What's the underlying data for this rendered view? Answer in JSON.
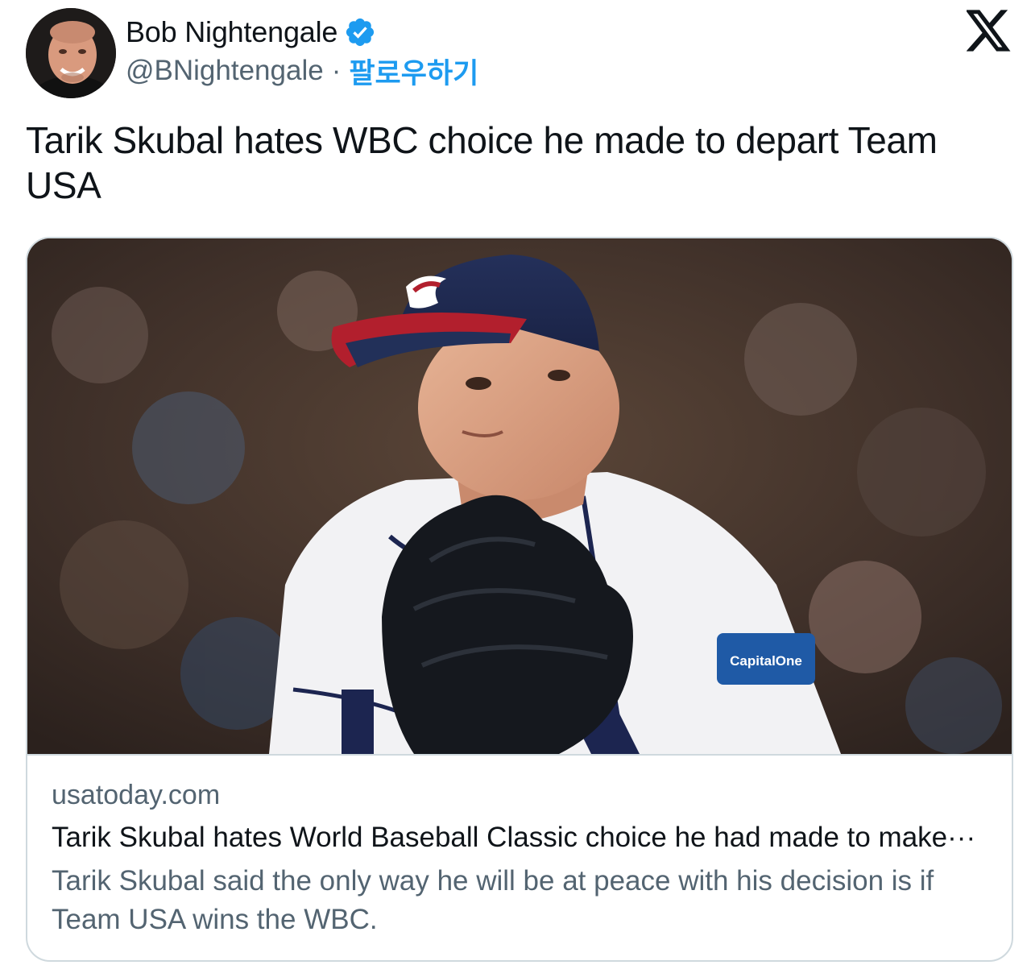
{
  "author": {
    "display_name": "Bob Nightengale",
    "handle": "@BNightengale",
    "separator": "·",
    "follow_label": "팔로우하기",
    "avatar_icon": "avatar-photo",
    "verified_icon": "verified-badge-icon"
  },
  "platform": {
    "logo_icon": "x-logo-icon"
  },
  "tweet": {
    "text": "Tarik Skubal hates WBC choice he made to depart Team USA"
  },
  "card": {
    "image_icon": "article-photo",
    "image_text": {
      "sponsor_patch": "CapitalOne"
    },
    "domain": "usatoday.com",
    "title": "Tarik Skubal hates World Baseball Classic choice he had made to make···",
    "description": "Tarik Skubal said the only way he will be at peace with his decision is if Team USA wins the WBC."
  },
  "colors": {
    "accent": "#1d9bf0",
    "text_primary": "#0f1419",
    "text_secondary": "#536471",
    "border": "#cfd9de"
  }
}
